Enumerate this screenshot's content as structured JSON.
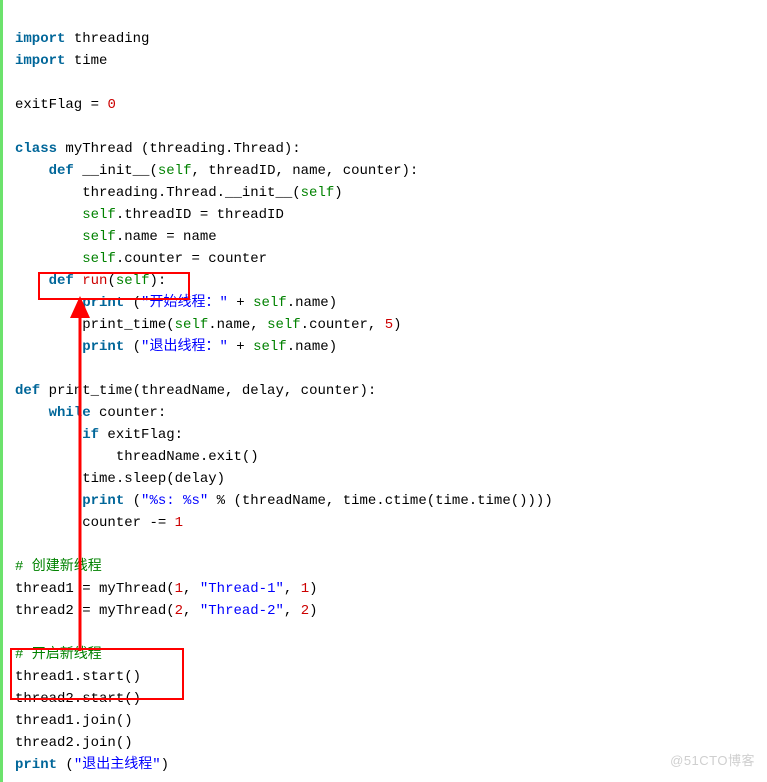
{
  "code": {
    "l1_kw1": "import",
    "l1_mod": "threading",
    "l2_kw1": "import",
    "l2_mod": "time",
    "l3": "",
    "l4_lhs": "exitFlag ",
    "l4_eq": "=",
    "l4_sp": " ",
    "l4_val": "0",
    "l5": "",
    "l6_kw": "class",
    "l6_name": "myThread (threading.Thread):",
    "l7_ind": "    ",
    "l7_kw": "def",
    "l7_name": "__init__",
    "l7_paren": "(",
    "l7_self": "self",
    "l7_rest": ", threadID, name, counter):",
    "l8_ind": "        ",
    "l8_txt": "threading.Thread.__init__(",
    "l8_self": "self",
    "l8_close": ")",
    "l9_ind": "        ",
    "l9_self": "self",
    "l9_dot": ".threadID ",
    "l9_eq": "=",
    "l9_rhs": " threadID",
    "l10_ind": "        ",
    "l10_self": "self",
    "l10_dot": ".name ",
    "l10_eq": "=",
    "l10_rhs": " name",
    "l11_ind": "        ",
    "l11_self": "self",
    "l11_dot": ".counter ",
    "l11_eq": "=",
    "l11_rhs": " counter",
    "l12_ind": "    ",
    "l12_kw": "def",
    "l12_name": "run",
    "l12_paren": "(",
    "l12_self": "self",
    "l12_close": "):",
    "l13_ind": "        ",
    "l13_print": "print",
    "l13_sp": " (",
    "l13_str": "\"开始线程：\"",
    "l13_plus": " + ",
    "l13_self": "self",
    "l13_rest": ".name)",
    "l14_ind": "        ",
    "l14_txt": "print_time(",
    "l14_self": "self",
    "l14_dot1": ".name, ",
    "l14_self2": "self",
    "l14_dot2": ".counter, ",
    "l14_num": "5",
    "l14_close": ")",
    "l15_ind": "        ",
    "l15_print": "print",
    "l15_sp": " (",
    "l15_str": "\"退出线程：\"",
    "l15_plus": " + ",
    "l15_self": "self",
    "l15_rest": ".name)",
    "l16": "",
    "l17_kw": "def",
    "l17_name": "print_time(threadName, delay, counter):",
    "l18_ind": "    ",
    "l18_kw": "while",
    "l18_rest": " counter:",
    "l19_ind": "        ",
    "l19_kw": "if",
    "l19_rest": " exitFlag:",
    "l20_ind": "            ",
    "l20_txt": "threadName.exit()",
    "l21_ind": "        ",
    "l21_txt": "time.sleep(delay)",
    "l22_ind": "        ",
    "l22_print": "print",
    "l22_sp": " (",
    "l22_str1": "\"%s: %s\"",
    "l22_mod": " % ",
    "l22_rest": "(threadName, time.ctime(time.time())))",
    "l23_ind": "        ",
    "l23_txt": "counter ",
    "l23_op": "-",
    "l23_eq": "=",
    "l23_sp": " ",
    "l23_num": "1",
    "l24": "",
    "l25_cmt": "# 创建新线程",
    "l26_lhs": "thread1 ",
    "l26_eq": "=",
    "l26_sp": " myThread(",
    "l26_n1": "1",
    "l26_c1": ", ",
    "l26_s": "\"Thread-1\"",
    "l26_c2": ", ",
    "l26_n2": "1",
    "l26_close": ")",
    "l27_lhs": "thread2 ",
    "l27_eq": "=",
    "l27_sp": " myThread(",
    "l27_n1": "2",
    "l27_c1": ", ",
    "l27_s": "\"Thread-2\"",
    "l27_c2": ", ",
    "l27_n2": "2",
    "l27_close": ")",
    "l28": "",
    "l29_cmt": "# 开启新线程",
    "l30": "thread1.start()",
    "l31": "thread2.start()",
    "l32": "thread1.join()",
    "l33": "thread2.join()",
    "l34_print": "print",
    "l34_sp": " (",
    "l34_str": "\"退出主线程\"",
    "l34_close": ")"
  },
  "watermark": "@51CTO博客",
  "annotations": {
    "box1_label": "def-run-highlight",
    "box2_label": "thread-start-highlight",
    "arrow_label": "arrow-start-to-run"
  }
}
